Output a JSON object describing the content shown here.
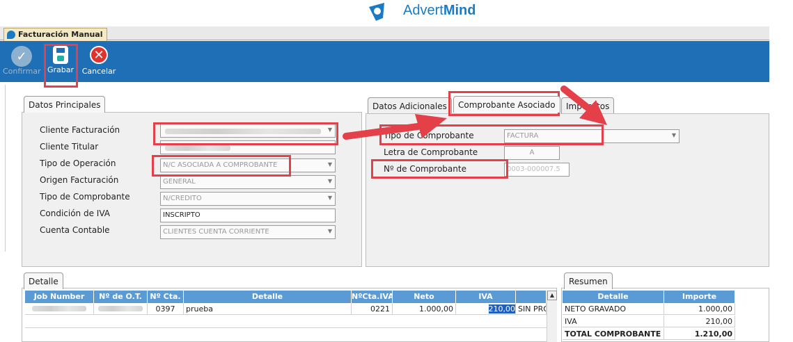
{
  "brand": {
    "name_light": "Advert",
    "name_bold": "Mind"
  },
  "window_tab": {
    "title": "Facturación Manual"
  },
  "toolbar": {
    "confirm_label": "Confirmar",
    "save_label": "Grabar",
    "cancel_label": "Cancelar"
  },
  "left_panel": {
    "tab": "Datos Principales",
    "fields": [
      {
        "label": "Cliente Facturación",
        "value": "",
        "has_dropdown": true
      },
      {
        "label": "Cliente Titular",
        "value": "",
        "has_dropdown": false
      },
      {
        "label": "Tipo de Operación",
        "value": "N/C ASOCIADA A COMPROBANTE",
        "has_dropdown": true
      },
      {
        "label": "Origen Facturación",
        "value": "GENERAL",
        "has_dropdown": true
      },
      {
        "label": "Tipo de Comprobante",
        "value": "N/CREDITO",
        "has_dropdown": true
      },
      {
        "label": "Condición de IVA",
        "value": "INSCRIPTO",
        "has_dropdown": false
      },
      {
        "label": "Cuenta Contable",
        "value": "CLIENTES CUENTA CORRIENTE",
        "has_dropdown": true
      }
    ]
  },
  "right_panel": {
    "tabs": [
      "Datos Adicionales",
      "Comprobante Asociado",
      "Impuestos"
    ],
    "active_tab": "Comprobante Asociado",
    "tipo_label": "Tipo de Comprobante",
    "tipo_value": "FACTURA",
    "letra_label": "Letra de Comprobante",
    "letra_value": "A",
    "numero_label": "Nº de Comprobante",
    "numero_value": "0003-000007.5"
  },
  "detalle": {
    "tab": "Detalle",
    "columns": [
      "Job Number",
      "Nº de O.T.",
      "Nº Cta.",
      "Detalle",
      "NºCta.IVA",
      "Neto",
      "IVA",
      ""
    ],
    "rows": [
      [
        "",
        "",
        "0397",
        "prueba",
        "0221",
        "1.000,00",
        "210,00",
        "SIN PRO"
      ]
    ]
  },
  "resumen": {
    "tab": "Resumen",
    "columns": [
      "Detalle",
      "Importe"
    ],
    "rows": [
      [
        "NETO GRAVADO",
        "1.000,00"
      ],
      [
        "IVA",
        "210,00"
      ],
      [
        "TOTAL COMPROBANTE",
        "1.210,00"
      ]
    ]
  },
  "colors": {
    "toolbar": "#1e6fb5",
    "grid_header": "#5b9bd5",
    "annotation": "#e4404a",
    "brand": "#1a7bc4"
  }
}
